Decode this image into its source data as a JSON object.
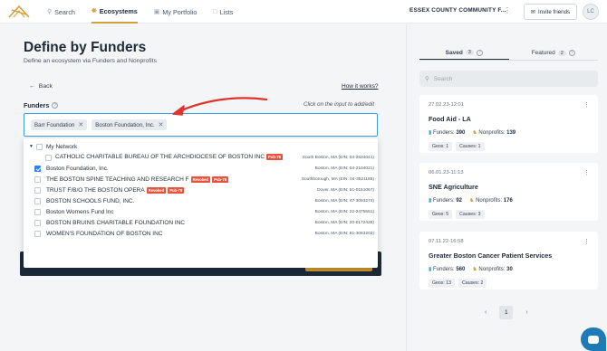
{
  "header": {
    "nav": [
      {
        "label": "Search",
        "icon": "search-icon"
      },
      {
        "label": "Ecosystems",
        "icon": "ecosystem-icon",
        "active": true
      },
      {
        "label": "My Portfolio",
        "icon": "briefcase-icon"
      },
      {
        "label": "Lists",
        "icon": "list-icon"
      }
    ],
    "org_name": "ESSEX COUNTY COMMUNITY F...",
    "invite_label": "Invite friends",
    "avatar_initials": "LC"
  },
  "main": {
    "title": "Define by Funders",
    "subtitle": "Define an ecosystem via Funders and Nonprofits",
    "back_label": "Back",
    "how_label": "How it works?",
    "funders_label": "Funders",
    "hint": "Click on the input to add/edit",
    "chips": [
      "Barr Foundation",
      "Boston Foundation, Inc."
    ],
    "dropdown": [
      {
        "name": "My Network",
        "ein": "",
        "checked": false,
        "level": 0,
        "tags": []
      },
      {
        "name": "CATHOLIC CHARITABLE BUREAU OF THE ARCHDIOCESE OF BOSTON INC",
        "ein": "South Boston, MA (EIN: 04-2534041)",
        "checked": false,
        "level": 1,
        "tags": [
          "Pub-78"
        ]
      },
      {
        "name": "Boston Foundation, Inc.",
        "ein": "Boston, MA (EIN: 04-2104021)",
        "checked": true,
        "level": 0,
        "tags": []
      },
      {
        "name": "THE BOSTON SPINE TEACHING AND RESEARCH F",
        "ein": "Southborough, MA (EIN: 04-3521185)",
        "checked": false,
        "level": 0,
        "tags": [
          "Revoked",
          "Pub-78"
        ]
      },
      {
        "name": "TRUST F/B/O THE BOSTON OPERA",
        "ein": "Dover, MA (EIN: 51-0151067)",
        "checked": false,
        "level": 0,
        "tags": [
          "Revoked",
          "Pub-78"
        ]
      },
      {
        "name": "BOSTON SCHOOLS FUND, INC.",
        "ein": "Boston, MA (EIN: 47-3093274)",
        "checked": false,
        "level": 0,
        "tags": []
      },
      {
        "name": "Boston Womens Fund Inc",
        "ein": "Boston, MA (EIN: 22-2475551)",
        "checked": false,
        "level": 0,
        "tags": []
      },
      {
        "name": "BOSTON BRUINS CHARITABLE FOUNDATION INC",
        "ein": "Boston, MA (EIN: 20-0172439)",
        "checked": false,
        "level": 0,
        "tags": []
      },
      {
        "name": "WOMEN'S FOUNDATION OF BOSTON INC",
        "ein": "Boston, MA (EIN: 81-3063203)",
        "checked": false,
        "level": 0,
        "tags": []
      }
    ]
  },
  "side": {
    "tabs": [
      {
        "label": "Saved",
        "count": "3",
        "active": true
      },
      {
        "label": "Featured",
        "count": "2",
        "active": false
      }
    ],
    "search_placeholder": "Search",
    "cards": [
      {
        "date": "27.02.23-12:01",
        "name": "Food Aid - LA",
        "funders_label": "Funders:",
        "funders": "390",
        "nonprofits_label": "Nonprofits:",
        "nonprofits": "139",
        "geos": "Geos: 1",
        "causes": "Causes: 1"
      },
      {
        "date": "06.01.23-11:13",
        "name": "SNE Agriculture",
        "funders_label": "Funders:",
        "funders": "92",
        "nonprofits_label": "Nonprofits:",
        "nonprofits": "176",
        "geos": "Geos: 5",
        "causes": "Causes: 3"
      },
      {
        "date": "07.11.22-16:58",
        "name": "Greater Boston Cancer Patient Services",
        "funders_label": "Funders:",
        "funders": "560",
        "nonprofits_label": "Nonprofits:",
        "nonprofits": "30",
        "geos": "Geos: 13",
        "causes": "Causes: 2"
      }
    ],
    "page": "1"
  },
  "colors": {
    "accent": "#d4a03a",
    "focus": "#3b9be0",
    "arrow": "#e0332b",
    "dark": "#1c2a3a",
    "tag": "#e5533d",
    "check": "#2f80ed"
  }
}
